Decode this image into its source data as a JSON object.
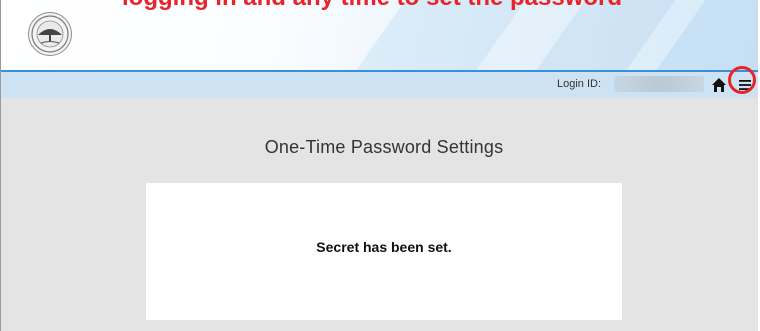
{
  "annotation": {
    "text": "logging in and any time to set the password",
    "highlight_color": "#e8232a"
  },
  "header": {
    "logo": "university-seal-logo"
  },
  "info_bar": {
    "login_label": "Login ID:",
    "login_value": "",
    "icons": [
      "home-icon",
      "hamburger-menu-icon"
    ]
  },
  "main": {
    "title": "One-Time Password Settings",
    "message": "Secret has been set."
  },
  "colors": {
    "accent": "#3b8fd6",
    "info_bar": "#cde2f2",
    "main_background": "#e4e4e4"
  }
}
